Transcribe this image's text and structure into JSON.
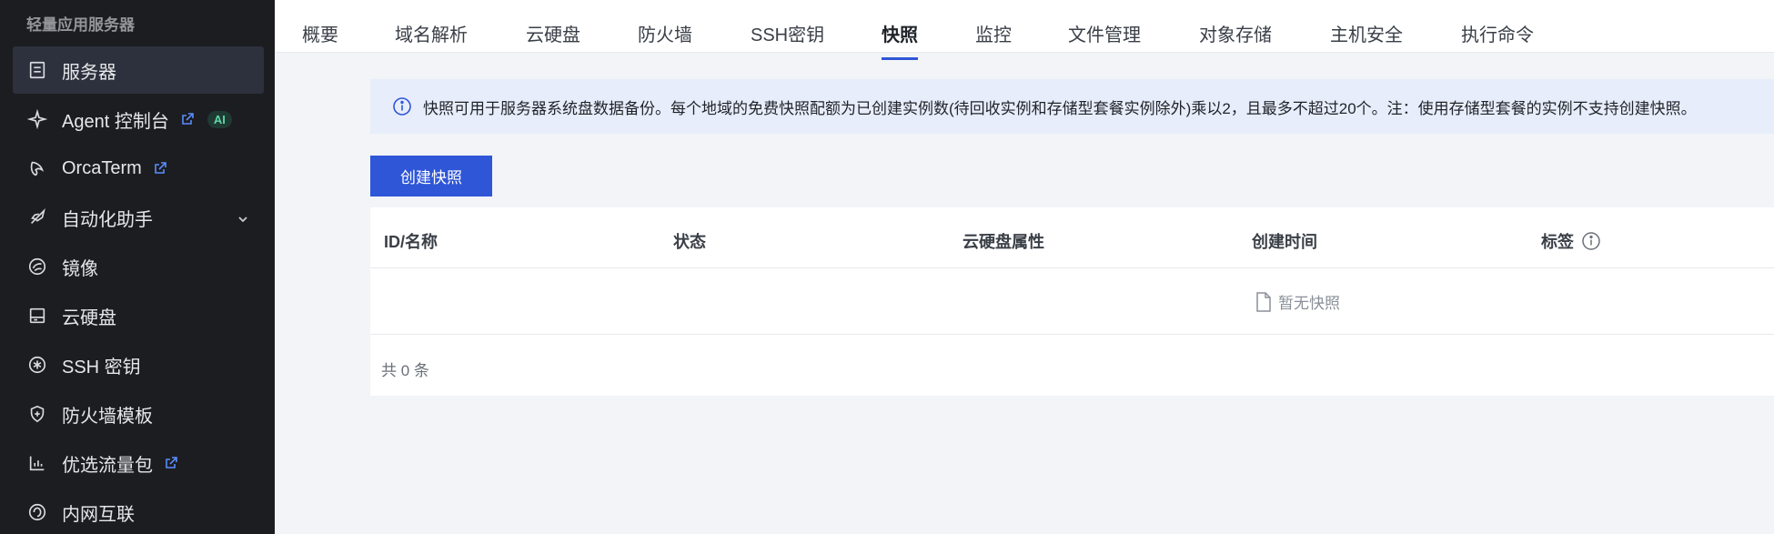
{
  "sidebar": {
    "title": "轻量应用服务器",
    "items": [
      {
        "label": "服务器",
        "icon": "server-icon"
      },
      {
        "label": "Agent 控制台",
        "icon": "sparkle-icon",
        "badge": "AI"
      },
      {
        "label": "OrcaTerm",
        "icon": "orca-icon"
      },
      {
        "label": "自动化助手",
        "icon": "rocket-icon"
      },
      {
        "label": "镜像",
        "icon": "image-disc-icon"
      },
      {
        "label": "云硬盘",
        "icon": "disk-icon"
      },
      {
        "label": "SSH 密钥",
        "icon": "asterisk-icon"
      },
      {
        "label": "防火墙模板",
        "icon": "shield-icon"
      },
      {
        "label": "优选流量包",
        "icon": "chart-icon"
      },
      {
        "label": "内网互联",
        "icon": "network-icon"
      }
    ]
  },
  "tabs": [
    {
      "label": "概要"
    },
    {
      "label": "域名解析"
    },
    {
      "label": "云硬盘"
    },
    {
      "label": "防火墙"
    },
    {
      "label": "SSH密钥"
    },
    {
      "label": "快照"
    },
    {
      "label": "监控"
    },
    {
      "label": "文件管理"
    },
    {
      "label": "对象存储"
    },
    {
      "label": "主机安全"
    },
    {
      "label": "执行命令"
    }
  ],
  "active_tab": "快照",
  "notice": {
    "text": "快照可用于服务器系统盘数据备份。每个地域的免费快照配额为已创建实例数(待回收实例和存储型套餐实例除外)乘以2，且最多不超过20个。注：使用存储型套餐的实例不支持创建快照。"
  },
  "create_button": "创建快照",
  "table": {
    "columns": [
      "ID/名称",
      "状态",
      "云硬盘属性",
      "创建时间",
      "标签"
    ],
    "empty_text": "暂无快照",
    "total": "共 0 条"
  },
  "colors": {
    "primary": "#2f56d7",
    "sidebar_bg": "#1c1d20",
    "ai_badge": "#5ed6a5"
  }
}
